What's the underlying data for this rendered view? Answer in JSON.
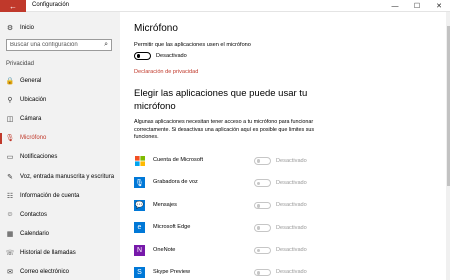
{
  "window": {
    "title": "Configuración",
    "back_glyph": "←",
    "controls": {
      "minimize": "—",
      "maximize": "☐",
      "close": "✕"
    }
  },
  "sidebar": {
    "home": {
      "label": "Inicio",
      "icon": "gear-icon",
      "glyph": "⚙"
    },
    "search": {
      "placeholder": "Buscar una configuración",
      "icon": "search-icon",
      "glyph": "⌕"
    },
    "section": "Privacidad",
    "items": [
      {
        "label": "General",
        "icon": "lock-icon",
        "glyph": "🔒",
        "active": false
      },
      {
        "label": "Ubicación",
        "icon": "location-pin-icon",
        "glyph": "⚲",
        "active": false
      },
      {
        "label": "Cámara",
        "icon": "camera-icon",
        "glyph": "◫",
        "active": false
      },
      {
        "label": "Micrófono",
        "icon": "microphone-icon",
        "glyph": "🎙",
        "active": true
      },
      {
        "label": "Notificaciones",
        "icon": "notification-icon",
        "glyph": "▭",
        "active": false
      },
      {
        "label": "Voz, entrada manuscrita y escritura",
        "icon": "pen-icon",
        "glyph": "✎",
        "active": false
      },
      {
        "label": "Información de cuenta",
        "icon": "account-card-icon",
        "glyph": "☷",
        "active": false
      },
      {
        "label": "Contactos",
        "icon": "contacts-icon",
        "glyph": "☺",
        "active": false
      },
      {
        "label": "Calendario",
        "icon": "calendar-icon",
        "glyph": "▦",
        "active": false
      },
      {
        "label": "Historial de llamadas",
        "icon": "call-history-icon",
        "glyph": "☏",
        "active": false
      },
      {
        "label": "Correo electrónico",
        "icon": "mail-icon",
        "glyph": "✉",
        "active": false
      }
    ]
  },
  "main": {
    "title": "Micrófono",
    "allow_text": "Permitir que las aplicaciones usen el micrófono",
    "allow_state": "Desactivado",
    "privacy_link": "Declaración de privacidad",
    "subtitle": "Elegir las aplicaciones que puede usar tu micrófono",
    "description": "Algunas aplicaciones necesitan tener acceso a tu micrófono para funcionar correctamente. Si desactivas una aplicación aquí es posible que limites sus funciones.",
    "apps": [
      {
        "name": "Cuenta de Microsoft",
        "state": "Desactivado",
        "icon": "microsoft-logo-icon",
        "glyph": "",
        "color": "#ffffff"
      },
      {
        "name": "Grabadora de voz",
        "state": "Desactivado",
        "icon": "voice-recorder-icon",
        "glyph": "🎙",
        "color": "#0078d7"
      },
      {
        "name": "Mensajes",
        "state": "Desactivado",
        "icon": "messaging-icon",
        "glyph": "💬",
        "color": "#0078d7"
      },
      {
        "name": "Microsoft Edge",
        "state": "Desactivado",
        "icon": "edge-icon",
        "glyph": "e",
        "color": "#0078d7"
      },
      {
        "name": "OneNote",
        "state": "Desactivado",
        "icon": "onenote-icon",
        "glyph": "N",
        "color": "#7719aa"
      },
      {
        "name": "Skype Preview",
        "state": "Desactivado",
        "icon": "skype-icon",
        "glyph": "S",
        "color": "#0078d7"
      }
    ]
  },
  "colors": {
    "accent": "#c0392b",
    "sidebar_bg": "#f2f2f2",
    "muted_text": "#9a9a9a"
  }
}
